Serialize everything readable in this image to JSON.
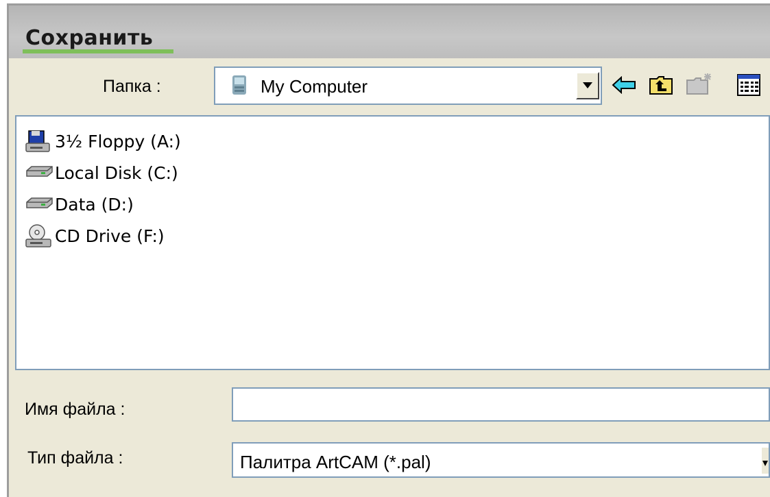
{
  "dialog": {
    "title": "Сохранить"
  },
  "folder": {
    "label": "Папка :",
    "value": "My Computer"
  },
  "toolbar": {
    "back_icon": "back-arrow-icon",
    "up_icon": "folder-up-icon",
    "new_folder_icon": "new-folder-icon",
    "view_icon": "view-menu-icon"
  },
  "files": [
    {
      "label": "3½ Floppy (A:)",
      "icon": "floppy-drive-icon"
    },
    {
      "label": "Local Disk (C:)",
      "icon": "hard-disk-icon"
    },
    {
      "label": "Data (D:)",
      "icon": "hard-disk-icon"
    },
    {
      "label": "CD Drive (F:)",
      "icon": "cd-drive-icon"
    }
  ],
  "filename": {
    "label": "Имя файла :",
    "value": ""
  },
  "filetype": {
    "label": "Тип файла :",
    "value": "Палитра ArtCAM (*.pal)"
  },
  "colors": {
    "field_border": "#7f9db9",
    "dialog_bg": "#ece9d8",
    "title_accent": "#7fbf5a"
  }
}
